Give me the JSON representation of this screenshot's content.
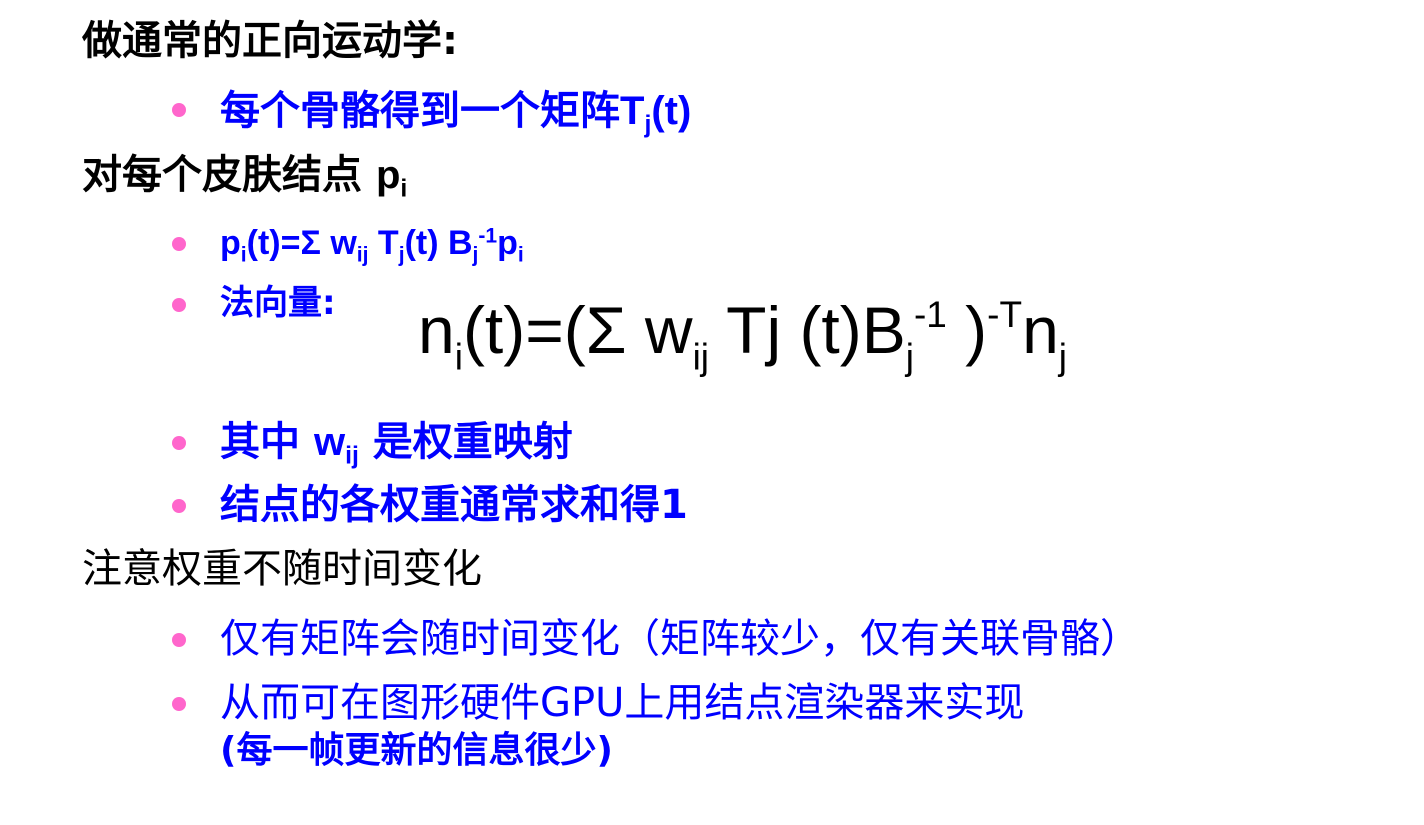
{
  "line1": {
    "text": "做通常的正向运动学:"
  },
  "line2": {
    "text": "每个骨骼得到一个矩阵",
    "matrix": "T",
    "matrix_sub": "j",
    "arg": "(t)"
  },
  "line3": {
    "text": "对每个皮肤结点 ",
    "p": "p",
    "p_sub": "i"
  },
  "line4": {
    "p": "p",
    "p_sub": "i",
    "eq": "(t)=Σ w",
    "w_sub": "ij",
    "T": " T",
    "T_sub": "j",
    "t": "(t) B",
    "B_sub": "j",
    "B_sup": "-1",
    "p2": "p",
    "p2_sub": "i"
  },
  "line5": {
    "label": "法向量:",
    "formula": {
      "n": "n",
      "n_sub": "i",
      "eq": "(t)=(Σ w",
      "w_sub": "ij",
      "T": " Tj (t)B",
      "B_sub": "j",
      "B_sup": "-1",
      "close": " )",
      "T_sup": "-T",
      "n2": "n",
      "n2_sub": "j"
    }
  },
  "line6": {
    "pre": "其中 ",
    "w": "w",
    "w_sub": "ij",
    "post": " 是权重映射"
  },
  "line7": {
    "text": "结点的各权重通常求和得1"
  },
  "line8": {
    "text": "注意权重不随时间变化"
  },
  "line9": {
    "text": "仅有矩阵会随时间变化（矩阵较少，仅有关联骨骼）"
  },
  "line10": {
    "text": "从而可在图形硬件GPU上用结点渲染器来实现"
  },
  "line11": {
    "text": "(每一帧更新的信息很少)"
  },
  "colors": {
    "primary": "#000000",
    "secondary": "#0000ff",
    "bullet": "#ff66cc",
    "background": "#ffffff"
  }
}
